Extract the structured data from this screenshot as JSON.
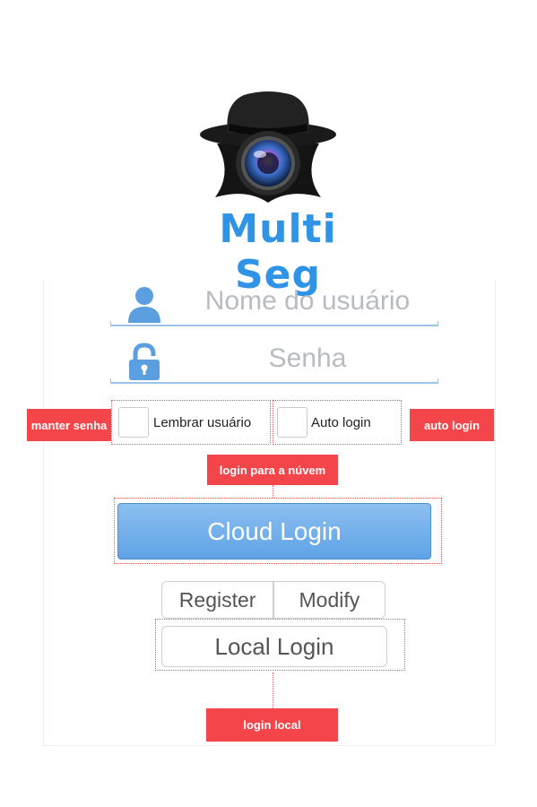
{
  "app": {
    "brand": "Multi Seg"
  },
  "login": {
    "username_placeholder": "Nome do usuário",
    "password_placeholder": "Senha",
    "remember_label": "Lembrar usuário",
    "auto_login_label": "Auto login",
    "cloud_login_label": "Cloud Login",
    "register_label": "Register",
    "modify_label": "Modify",
    "local_login_label": "Local Login"
  },
  "annotations": {
    "keep_password": "manter senha",
    "auto_login": "auto login",
    "cloud_login": "login para a núvem",
    "local_login": "login local"
  },
  "colors": {
    "brand": "#2f93e6",
    "annotation": "#f3454a",
    "cloud_button": "#6aaae8",
    "icon": "#5b9fe0"
  },
  "icons": {
    "logo": "spy-hat-camera-icon",
    "username": "user-icon",
    "password": "lock-icon"
  }
}
